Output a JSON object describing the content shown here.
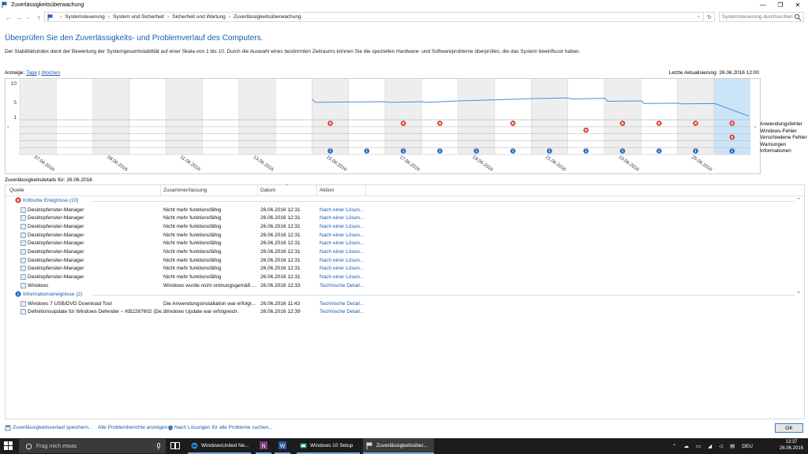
{
  "window": {
    "title": "Zuverlässigkeitsüberwachung",
    "controls": {
      "minimize": "—",
      "maximize": "❐",
      "close": "✕"
    }
  },
  "addressbar": {
    "breadcrumbs": [
      "Systemsteuerung",
      "System und Sicherheit",
      "Sicherheit und Wartung",
      "Zuverlässigkeitsüberwachung"
    ],
    "search_placeholder": "Systemsteuerung durchsuchen"
  },
  "page": {
    "heading": "Überprüfen Sie den Zuverlässigkeits- und Problemverlauf des Computers.",
    "description": "Der Stabilitätsindex dient der Bewertung der Systemgesamtstabilität auf einer Skala von 1 bis 10. Durch die Auswahl eines bestimmten Zeitraums können Sie die speziellen Hardware- und Softwareprobleme überprüfen, die das System beeinflusst haben.",
    "view_label": "Anzeige:",
    "view_days": "Tage",
    "view_sep": "|",
    "view_weeks": "Wochen",
    "last_update": "Letzte Aktualisierung: 26.06.2016 12:00"
  },
  "chart_data": {
    "type": "line",
    "title": "",
    "ylabel": "",
    "ylim": [
      0,
      10
    ],
    "yticks": [
      10,
      5,
      1
    ],
    "x_tick_labels": [
      "07.06.2016",
      "09.06.2016",
      "11.06.2016",
      "13.06.2016",
      "15.06.2016",
      "17.06.2016",
      "19.06.2016",
      "21.06.2016",
      "23.06.2016",
      "25.06.2016"
    ],
    "days": [
      "07.06.2016",
      "08.06.2016",
      "09.06.2016",
      "10.06.2016",
      "11.06.2016",
      "12.06.2016",
      "13.06.2016",
      "14.06.2016",
      "15.06.2016",
      "16.06.2016",
      "17.06.2016",
      "18.06.2016",
      "19.06.2016",
      "20.06.2016",
      "21.06.2016",
      "22.06.2016",
      "23.06.2016",
      "24.06.2016",
      "25.06.2016",
      "26.06.2016"
    ],
    "stability_series": {
      "name": "Stabilitätsindex",
      "points": [
        {
          "x": "15.06.2016",
          "y": 5.5
        },
        {
          "x": "15.06.2016",
          "y": 4.6
        },
        {
          "x": "16.06.2016",
          "y": 4.7
        },
        {
          "x": "17.06.2016",
          "y": 4.8
        },
        {
          "x": "17.06.2016",
          "y": 4.6
        },
        {
          "x": "18.06.2016",
          "y": 4.8
        },
        {
          "x": "18.06.2016",
          "y": 4.6
        },
        {
          "x": "19.06.2016",
          "y": 5.0
        },
        {
          "x": "20.06.2016",
          "y": 5.3
        },
        {
          "x": "21.06.2016",
          "y": 5.6
        },
        {
          "x": "22.06.2016",
          "y": 5.8
        },
        {
          "x": "22.06.2016",
          "y": 5.5
        },
        {
          "x": "23.06.2016",
          "y": 5.7
        },
        {
          "x": "23.06.2016",
          "y": 4.9
        },
        {
          "x": "24.06.2016",
          "y": 5.0
        },
        {
          "x": "24.06.2016",
          "y": 4.3
        },
        {
          "x": "25.06.2016",
          "y": 4.4
        },
        {
          "x": "25.06.2016",
          "y": 4.2
        },
        {
          "x": "26.06.2016",
          "y": 4.3
        },
        {
          "x": "26.06.2016",
          "y": 1.0
        }
      ]
    },
    "event_rows": [
      "Anwendungsfehler",
      "Windows-Fehler",
      "Verschiedene Fehler",
      "Warnungen",
      "Informationen"
    ],
    "events": [
      {
        "day": "15.06.2016",
        "row": 0,
        "kind": "error"
      },
      {
        "day": "17.06.2016",
        "row": 0,
        "kind": "error"
      },
      {
        "day": "18.06.2016",
        "row": 0,
        "kind": "error"
      },
      {
        "day": "20.06.2016",
        "row": 0,
        "kind": "error"
      },
      {
        "day": "23.06.2016",
        "row": 0,
        "kind": "error"
      },
      {
        "day": "24.06.2016",
        "row": 0,
        "kind": "error"
      },
      {
        "day": "25.06.2016",
        "row": 0,
        "kind": "error"
      },
      {
        "day": "26.06.2016",
        "row": 0,
        "kind": "error"
      },
      {
        "day": "22.06.2016",
        "row": 1,
        "kind": "error"
      },
      {
        "day": "26.06.2016",
        "row": 2,
        "kind": "error"
      },
      {
        "day": "15.06.2016",
        "row": 4,
        "kind": "info"
      },
      {
        "day": "16.06.2016",
        "row": 4,
        "kind": "info"
      },
      {
        "day": "17.06.2016",
        "row": 4,
        "kind": "info"
      },
      {
        "day": "18.06.2016",
        "row": 4,
        "kind": "info"
      },
      {
        "day": "19.06.2016",
        "row": 4,
        "kind": "info"
      },
      {
        "day": "20.06.2016",
        "row": 4,
        "kind": "info"
      },
      {
        "day": "21.06.2016",
        "row": 4,
        "kind": "info"
      },
      {
        "day": "22.06.2016",
        "row": 4,
        "kind": "info"
      },
      {
        "day": "23.06.2016",
        "row": 4,
        "kind": "info"
      },
      {
        "day": "24.06.2016",
        "row": 4,
        "kind": "info"
      },
      {
        "day": "25.06.2016",
        "row": 4,
        "kind": "info"
      },
      {
        "day": "26.06.2016",
        "row": 4,
        "kind": "info"
      }
    ],
    "selected_day": "26.06.2016",
    "colors": {
      "line": "#4a90d9",
      "error": "#d9352b",
      "info": "#1f6fc5",
      "selected": "#cce4f7",
      "shade": "#eeeeee"
    }
  },
  "details": {
    "label": "Zuverlässigkeitsdetails für: 26.06.2016",
    "columns": [
      "Quelle",
      "Zusammenfassung",
      "Datum",
      "Aktion"
    ],
    "groups": [
      {
        "label": "Kritische Ereignisse (10)",
        "icon": "error-icon",
        "rows": [
          [
            "Desktopfenster-Manager",
            "Nicht mehr funktionsfähig",
            "26.06.2016 12:31",
            "Nach einer Lösun..."
          ],
          [
            "Desktopfenster-Manager",
            "Nicht mehr funktionsfähig",
            "26.06.2016 12:31",
            "Nach einer Lösun..."
          ],
          [
            "Desktopfenster-Manager",
            "Nicht mehr funktionsfähig",
            "26.06.2016 12:31",
            "Nach einer Lösun..."
          ],
          [
            "Desktopfenster-Manager",
            "Nicht mehr funktionsfähig",
            "26.06.2016 12:31",
            "Nach einer Lösun..."
          ],
          [
            "Desktopfenster-Manager",
            "Nicht mehr funktionsfähig",
            "26.06.2016 12:31",
            "Nach einer Lösun..."
          ],
          [
            "Desktopfenster-Manager",
            "Nicht mehr funktionsfähig",
            "26.06.2016 12:31",
            "Nach einer Lösun..."
          ],
          [
            "Desktopfenster-Manager",
            "Nicht mehr funktionsfähig",
            "26.06.2016 12:31",
            "Nach einer Lösun..."
          ],
          [
            "Desktopfenster-Manager",
            "Nicht mehr funktionsfähig",
            "26.06.2016 12:31",
            "Nach einer Lösun..."
          ],
          [
            "Desktopfenster-Manager",
            "Nicht mehr funktionsfähig",
            "26.06.2016 12:31",
            "Nach einer Lösun..."
          ],
          [
            "Windows",
            "Windows wurde nicht ordnungsgemäß ...",
            "26.06.2016 12:33",
            "Technische Detail..."
          ]
        ]
      },
      {
        "label": "Informationsereignisse (2)",
        "icon": "info-icon",
        "rows": [
          [
            "Windows 7 USB/DVD Download Tool",
            "Die Anwendungsinstallation war erfolgr...",
            "26.06.2016 11:43",
            "Technische Detail..."
          ],
          [
            "Definitionsupdate für Windows Defender – KB2267602 (De...",
            "Windows Update war erfolgreich.",
            "26.06.2016 12:39",
            "Technische Detail..."
          ]
        ]
      }
    ]
  },
  "bottom": {
    "link_save": "Zuverlässigkeitsverlauf speichern...",
    "link_all": "Alle Problemberichte anzeigen",
    "link_solutions": "Nach Lösungen für alle Probleme suchen...",
    "ok": "OK"
  },
  "taskbar": {
    "search_placeholder": "Frag mich etwas",
    "items": [
      "WindowsUnited Ne...",
      "Windows 10 Setup",
      "Zuverlässigkeitsüber..."
    ],
    "language": "DEU",
    "time": "13:37",
    "date": "26.06.2016"
  }
}
